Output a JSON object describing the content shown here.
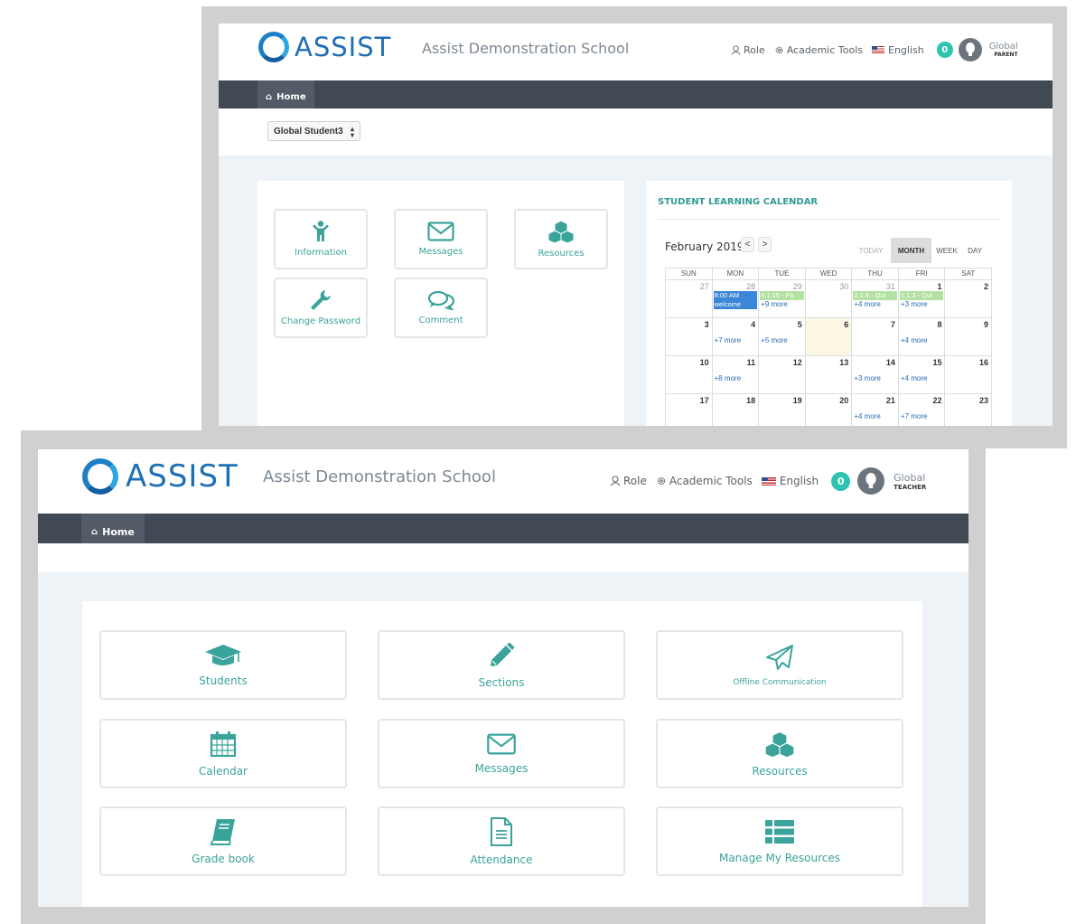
{
  "parent_window": {
    "header": {
      "logo_text": "ASSIST",
      "school_name": "Assist Demonstration School",
      "role_link": "Role",
      "academic_tools_link": "Academic Tools",
      "language_link": "English",
      "notification_count": "0",
      "user_name": "Global",
      "user_role": "PARENT"
    },
    "nav": {
      "home_label": "Home"
    },
    "student_select": {
      "value": "Global Student3"
    },
    "tiles": [
      {
        "label": "Information",
        "icon": "person-icon"
      },
      {
        "label": "Messages",
        "icon": "envelope-icon"
      },
      {
        "label": "Resources",
        "icon": "cubes-icon"
      },
      {
        "label": "Change Password",
        "icon": "wrench-icon"
      },
      {
        "label": "Comment",
        "icon": "comments-icon"
      }
    ],
    "calendar": {
      "title": "STUDENT LEARNING CALENDAR",
      "month_label": "February 2019",
      "prev_label": "<",
      "next_label": ">",
      "views": {
        "today": "TODAY",
        "month": "MONTH",
        "week": "WEEK",
        "day": "DAY"
      },
      "active_view": "MONTH",
      "weekdays": [
        "SUN",
        "MON",
        "TUE",
        "WED",
        "THU",
        "FRI",
        "SAT"
      ],
      "weeks": [
        [
          {
            "day": "27",
            "other": true
          },
          {
            "day": "28",
            "other": true,
            "events": [
              {
                "text": "8:00 AM",
                "color": "blue"
              },
              {
                "text": "welcome",
                "color": "blue"
              }
            ]
          },
          {
            "day": "29",
            "other": true,
            "events": [
              {
                "text": "4.1.10 - Pu",
                "color": "green"
              }
            ],
            "more": "+9 more"
          },
          {
            "day": "30",
            "other": true
          },
          {
            "day": "31",
            "other": true,
            "events": [
              {
                "text": "2.1.4 - Qui",
                "color": "green"
              }
            ],
            "more": "+4 more"
          },
          {
            "day": "1",
            "events": [
              {
                "text": "1.1.3 - Qui",
                "color": "green"
              }
            ],
            "more": "+3 more"
          },
          {
            "day": "2"
          }
        ],
        [
          {
            "day": "3"
          },
          {
            "day": "4",
            "more": "+7 more"
          },
          {
            "day": "5",
            "more": "+5 more"
          },
          {
            "day": "6",
            "today": true
          },
          {
            "day": "7"
          },
          {
            "day": "8",
            "more": "+4 more"
          },
          {
            "day": "9"
          }
        ],
        [
          {
            "day": "10"
          },
          {
            "day": "11",
            "more": "+8 more"
          },
          {
            "day": "12"
          },
          {
            "day": "13"
          },
          {
            "day": "14",
            "more": "+3 more"
          },
          {
            "day": "15",
            "more": "+4 more"
          },
          {
            "day": "16"
          }
        ],
        [
          {
            "day": "17"
          },
          {
            "day": "18"
          },
          {
            "day": "19"
          },
          {
            "day": "20"
          },
          {
            "day": "21",
            "more": "+4 more"
          },
          {
            "day": "22",
            "more": "+7 more"
          },
          {
            "day": "23"
          }
        ]
      ]
    }
  },
  "teacher_window": {
    "header": {
      "logo_text": "ASSIST",
      "school_name": "Assist Demonstration School",
      "role_link": "Role",
      "academic_tools_link": "Academic Tools",
      "language_link": "English",
      "notification_count": "0",
      "user_name": "Global",
      "user_role": "TEACHER"
    },
    "nav": {
      "home_label": "Home"
    },
    "tiles": [
      {
        "label": "Students",
        "icon": "graduation-cap-icon"
      },
      {
        "label": "Sections",
        "icon": "pencil-icon"
      },
      {
        "label": "Offline Communication",
        "icon": "paper-plane-icon"
      },
      {
        "label": "Calendar",
        "icon": "calendar-icon"
      },
      {
        "label": "Messages",
        "icon": "envelope-icon"
      },
      {
        "label": "Resources",
        "icon": "cubes-icon"
      },
      {
        "label": "Grade book",
        "icon": "book-icon"
      },
      {
        "label": "Attendance",
        "icon": "document-icon"
      },
      {
        "label": "Manage My Resources",
        "icon": "list-icon"
      }
    ]
  },
  "colors": {
    "accent": "#3aa49a",
    "navbar": "#414a54",
    "badge": "#2cc4b0",
    "logo_blue": "#1f6fb5",
    "frame_gray": "#d0d0d0",
    "page_bg": "#eef3f7"
  }
}
